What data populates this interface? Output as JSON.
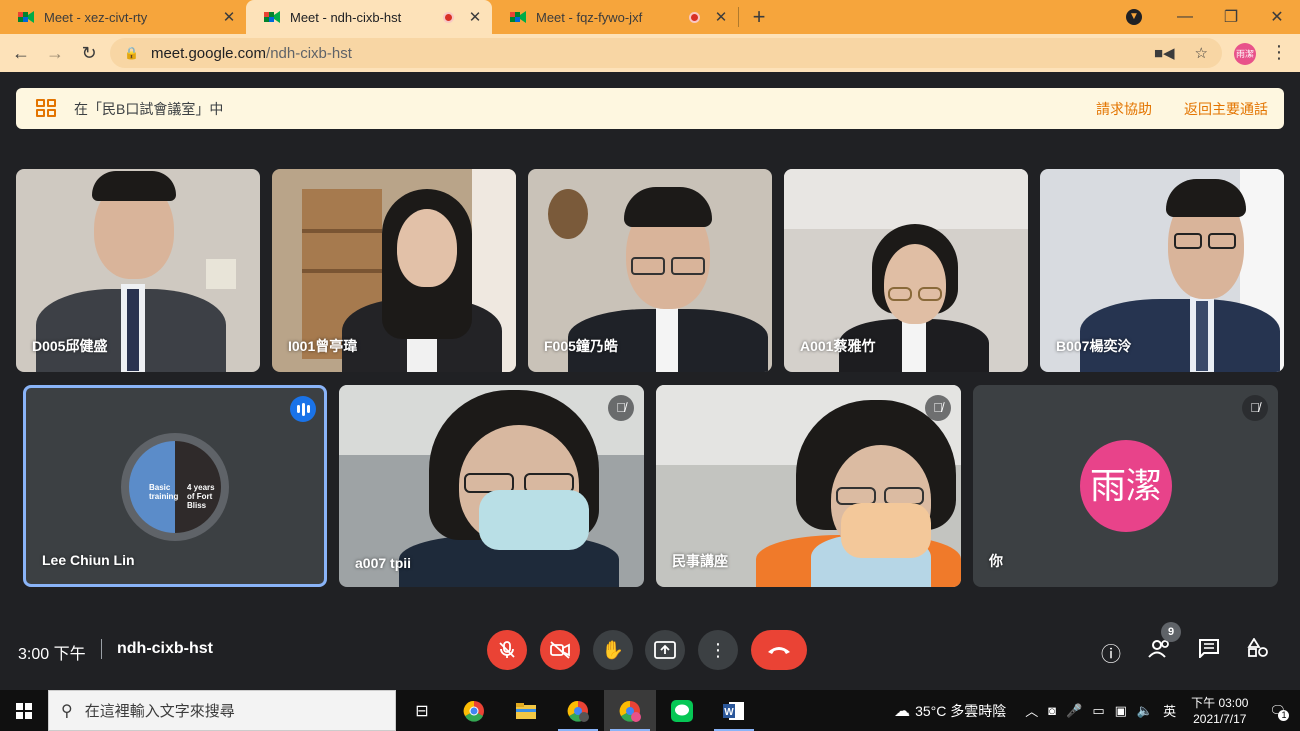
{
  "browser": {
    "tabs": [
      {
        "title": "Meet - xez-civt-rty",
        "recording": false,
        "active": false
      },
      {
        "title": "Meet - ndh-cixb-hst",
        "recording": true,
        "active": true
      },
      {
        "title": "Meet - fqz-fywo-jxf",
        "recording": true,
        "active": false
      }
    ],
    "url_host": "meet.google.com",
    "url_path": "/ndh-cixb-hst",
    "profile_label": "雨潔"
  },
  "banner": {
    "message": "在「民B口試會議室」中",
    "help_link": "請求協助",
    "return_link": "返回主要通話"
  },
  "participants_top": [
    {
      "name": "D005邱健盛"
    },
    {
      "name": "I001曾亭瑋"
    },
    {
      "name": "F005鐘乃皓"
    },
    {
      "name": "A001蔡雅竹"
    },
    {
      "name": "B007楊奕泠"
    }
  ],
  "participants_bottom": [
    {
      "name": "Lee Chiun Lin",
      "avatar_text_1": "Basic training",
      "avatar_text_2": "4 years of Fort Bliss"
    },
    {
      "name": "a007 tpii"
    },
    {
      "name": "民事講座"
    },
    {
      "name": "你",
      "avatar_initials": "雨潔"
    }
  ],
  "bottombar": {
    "time": "3:00 下午",
    "meeting_code": "ndh-cixb-hst",
    "people_count": "9"
  },
  "taskbar": {
    "search_placeholder": "在這裡輸入文字來搜尋",
    "weather": "35°C 多雲時陰",
    "ime": "英",
    "time": "下午 03:00",
    "date": "2021/7/17",
    "notification_count": "1"
  },
  "colors": {
    "tab_strip": "#f6a53c",
    "toolbar": "#fde2b9",
    "meet_bg": "#202124",
    "danger": "#ea4335",
    "accent_orange": "#e37400",
    "speaking_blue": "#1a73e8",
    "avatar_pink": "#e8438a"
  }
}
